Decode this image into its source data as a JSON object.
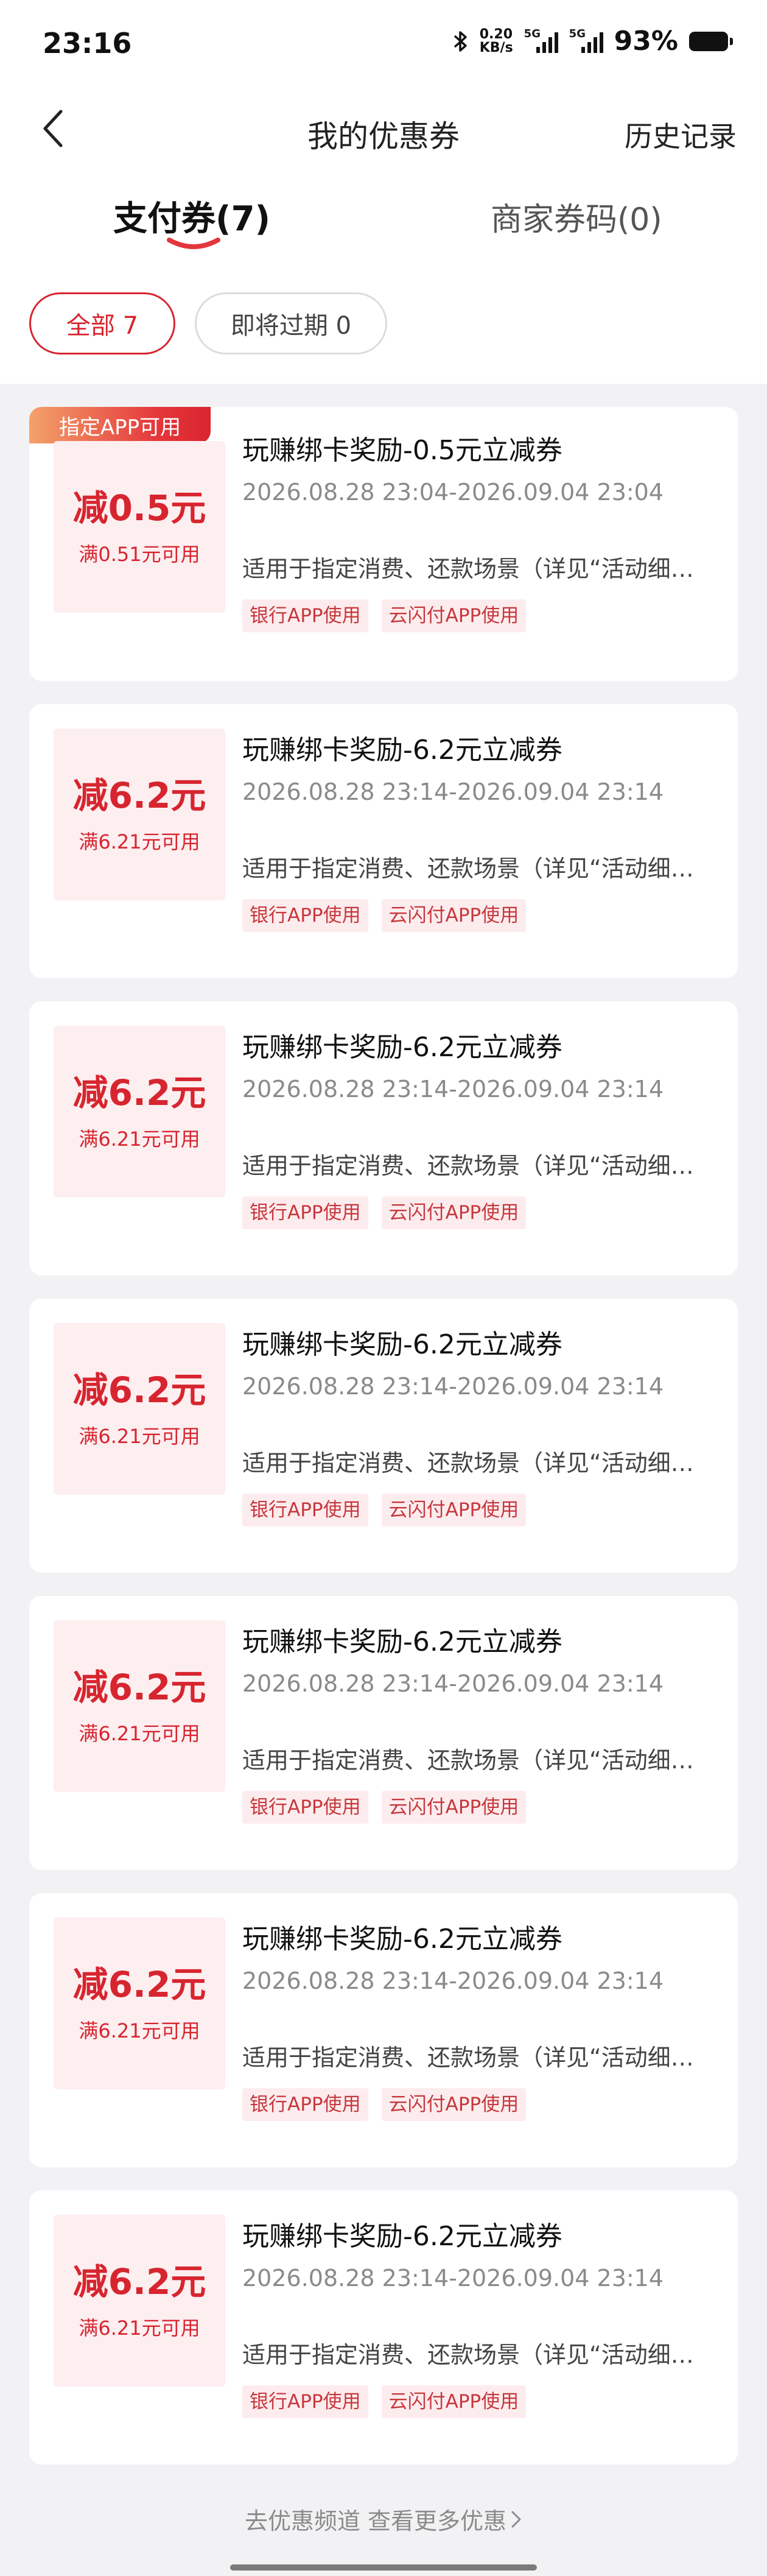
{
  "status_bar": {
    "time": "23:16",
    "net_speed_value": "0.20",
    "net_speed_unit": "KB/s",
    "signal_label_1": "5G",
    "signal_label_2": "5G",
    "battery_percent": "93%",
    "icons": [
      "bluetooth-icon",
      "signal-icon",
      "battery-icon"
    ]
  },
  "header": {
    "title": "我的优惠券",
    "history_label": "历史记录",
    "back_icon": "chevron-left-icon"
  },
  "tabs": [
    {
      "label": "支付券(7)",
      "active": true
    },
    {
      "label": "商家券码(0)",
      "active": false
    }
  ],
  "filters": [
    {
      "label": "全部 7",
      "selected": true
    },
    {
      "label": "即将过期 0",
      "selected": false
    }
  ],
  "coupons": [
    {
      "tag": "指定APP可用",
      "amount": "减0.5元",
      "threshold": "满0.51元可用",
      "title": "玩赚绑卡奖励-0.5元立减券",
      "date_range": "2026.08.28 23:04-2026.09.04 23:04",
      "description": "适用于指定消费、还款场景（详见“活动细则”）",
      "badges": [
        "银行APP使用",
        "云闪付APP使用"
      ]
    },
    {
      "tag": "",
      "amount": "减6.2元",
      "threshold": "满6.21元可用",
      "title": "玩赚绑卡奖励-6.2元立减券",
      "date_range": "2026.08.28 23:14-2026.09.04 23:14",
      "description": "适用于指定消费、还款场景（详见“活动细则”）",
      "badges": [
        "银行APP使用",
        "云闪付APP使用"
      ]
    },
    {
      "tag": "",
      "amount": "减6.2元",
      "threshold": "满6.21元可用",
      "title": "玩赚绑卡奖励-6.2元立减券",
      "date_range": "2026.08.28 23:14-2026.09.04 23:14",
      "description": "适用于指定消费、还款场景（详见“活动细则”）",
      "badges": [
        "银行APP使用",
        "云闪付APP使用"
      ]
    },
    {
      "tag": "",
      "amount": "减6.2元",
      "threshold": "满6.21元可用",
      "title": "玩赚绑卡奖励-6.2元立减券",
      "date_range": "2026.08.28 23:14-2026.09.04 23:14",
      "description": "适用于指定消费、还款场景（详见“活动细则”）",
      "badges": [
        "银行APP使用",
        "云闪付APP使用"
      ]
    },
    {
      "tag": "",
      "amount": "减6.2元",
      "threshold": "满6.21元可用",
      "title": "玩赚绑卡奖励-6.2元立减券",
      "date_range": "2026.08.28 23:14-2026.09.04 23:14",
      "description": "适用于指定消费、还款场景（详见“活动细则”）",
      "badges": [
        "银行APP使用",
        "云闪付APP使用"
      ]
    },
    {
      "tag": "",
      "amount": "减6.2元",
      "threshold": "满6.21元可用",
      "title": "玩赚绑卡奖励-6.2元立减券",
      "date_range": "2026.08.28 23:14-2026.09.04 23:14",
      "description": "适用于指定消费、还款场景（详见“活动细则”）",
      "badges": [
        "银行APP使用",
        "云闪付APP使用"
      ]
    },
    {
      "tag": "",
      "amount": "减6.2元",
      "threshold": "满6.21元可用",
      "title": "玩赚绑卡奖励-6.2元立减券",
      "date_range": "2026.08.28 23:14-2026.09.04 23:14",
      "description": "适用于指定消费、还款场景（详见“活动细则”）",
      "badges": [
        "银行APP使用",
        "云闪付APP使用"
      ]
    }
  ],
  "footer": {
    "link_text": "去优惠频道 查看更多优惠",
    "link_icon": "chevron-right-icon"
  },
  "colors": {
    "accent": "#d7252f",
    "badge_bg": "#fdecee",
    "amount_bg": "#fdeef0",
    "page_bg": "#f2f2f4"
  }
}
